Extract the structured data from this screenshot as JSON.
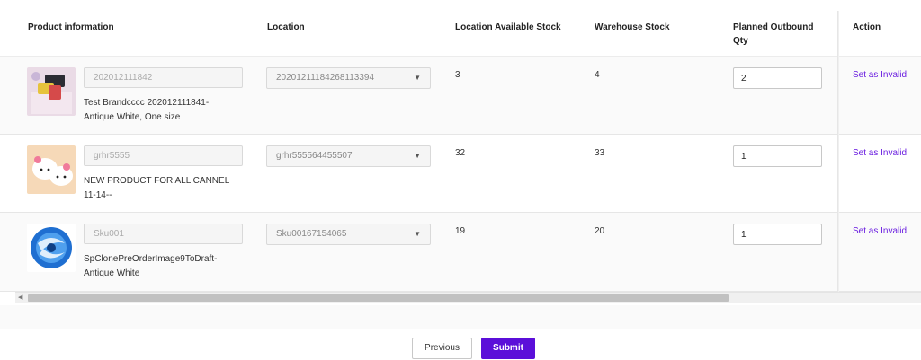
{
  "table": {
    "headers": {
      "product": "Product information",
      "location": "Location",
      "loc_stock": "Location Available Stock",
      "wh_stock": "Warehouse Stock",
      "planned_1": "Planned Outbound",
      "planned_2": "Qty",
      "action": "Action"
    },
    "rows": [
      {
        "sku": "202012111842",
        "name_1": "Test Brandcccc 202012111841-",
        "name_2": "Antique White, One size",
        "location": "20201211184268113394",
        "loc_stock": "3",
        "wh_stock": "4",
        "qty": "2",
        "action": "Set as Invalid"
      },
      {
        "sku": "grhr5555",
        "name_1": "NEW PRODUCT FOR ALL CANNEL",
        "name_2": "11-14--",
        "location": "grhr555564455507",
        "loc_stock": "32",
        "wh_stock": "33",
        "qty": "1",
        "action": "Set as Invalid"
      },
      {
        "sku": "Sku001",
        "name_1": "SpClonePreOrderImage9ToDraft-",
        "name_2": "Antique White",
        "location": "Sku00167154065",
        "loc_stock": "19",
        "wh_stock": "20",
        "qty": "1",
        "action": "Set as Invalid"
      }
    ]
  },
  "icons": {
    "dropdown": "caret-down-icon",
    "scroll_left": "arrow-left-icon"
  },
  "footer": {
    "previous_label": "Previous",
    "submit_label": "Submit"
  },
  "colors": {
    "accent": "#5b0fd9",
    "link": "#6a1de0"
  }
}
